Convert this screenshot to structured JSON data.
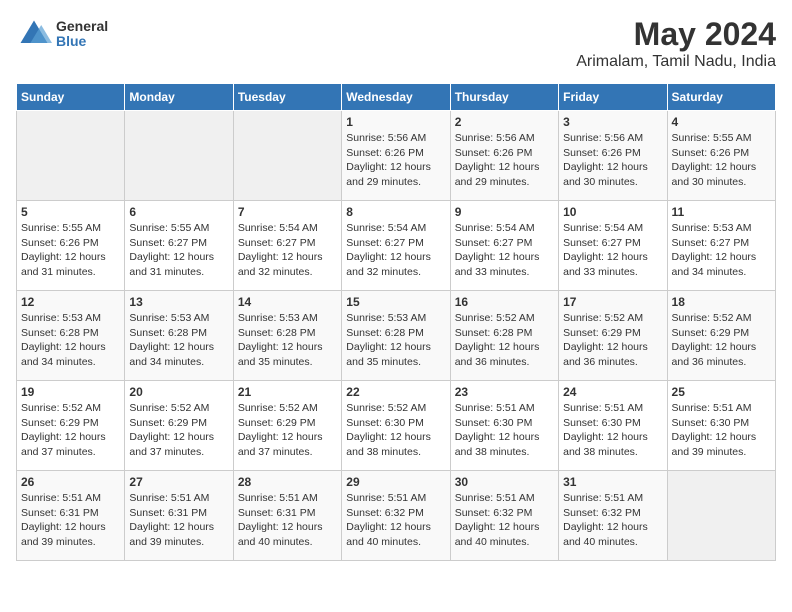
{
  "header": {
    "logo_line1": "General",
    "logo_line2": "Blue",
    "title": "May 2024",
    "subtitle": "Arimalam, Tamil Nadu, India"
  },
  "calendar": {
    "days_of_week": [
      "Sunday",
      "Monday",
      "Tuesday",
      "Wednesday",
      "Thursday",
      "Friday",
      "Saturday"
    ],
    "weeks": [
      [
        {
          "day": "",
          "info": ""
        },
        {
          "day": "",
          "info": ""
        },
        {
          "day": "",
          "info": ""
        },
        {
          "day": "1",
          "info": "Sunrise: 5:56 AM\nSunset: 6:26 PM\nDaylight: 12 hours\nand 29 minutes."
        },
        {
          "day": "2",
          "info": "Sunrise: 5:56 AM\nSunset: 6:26 PM\nDaylight: 12 hours\nand 29 minutes."
        },
        {
          "day": "3",
          "info": "Sunrise: 5:56 AM\nSunset: 6:26 PM\nDaylight: 12 hours\nand 30 minutes."
        },
        {
          "day": "4",
          "info": "Sunrise: 5:55 AM\nSunset: 6:26 PM\nDaylight: 12 hours\nand 30 minutes."
        }
      ],
      [
        {
          "day": "5",
          "info": "Sunrise: 5:55 AM\nSunset: 6:26 PM\nDaylight: 12 hours\nand 31 minutes."
        },
        {
          "day": "6",
          "info": "Sunrise: 5:55 AM\nSunset: 6:27 PM\nDaylight: 12 hours\nand 31 minutes."
        },
        {
          "day": "7",
          "info": "Sunrise: 5:54 AM\nSunset: 6:27 PM\nDaylight: 12 hours\nand 32 minutes."
        },
        {
          "day": "8",
          "info": "Sunrise: 5:54 AM\nSunset: 6:27 PM\nDaylight: 12 hours\nand 32 minutes."
        },
        {
          "day": "9",
          "info": "Sunrise: 5:54 AM\nSunset: 6:27 PM\nDaylight: 12 hours\nand 33 minutes."
        },
        {
          "day": "10",
          "info": "Sunrise: 5:54 AM\nSunset: 6:27 PM\nDaylight: 12 hours\nand 33 minutes."
        },
        {
          "day": "11",
          "info": "Sunrise: 5:53 AM\nSunset: 6:27 PM\nDaylight: 12 hours\nand 34 minutes."
        }
      ],
      [
        {
          "day": "12",
          "info": "Sunrise: 5:53 AM\nSunset: 6:28 PM\nDaylight: 12 hours\nand 34 minutes."
        },
        {
          "day": "13",
          "info": "Sunrise: 5:53 AM\nSunset: 6:28 PM\nDaylight: 12 hours\nand 34 minutes."
        },
        {
          "day": "14",
          "info": "Sunrise: 5:53 AM\nSunset: 6:28 PM\nDaylight: 12 hours\nand 35 minutes."
        },
        {
          "day": "15",
          "info": "Sunrise: 5:53 AM\nSunset: 6:28 PM\nDaylight: 12 hours\nand 35 minutes."
        },
        {
          "day": "16",
          "info": "Sunrise: 5:52 AM\nSunset: 6:28 PM\nDaylight: 12 hours\nand 36 minutes."
        },
        {
          "day": "17",
          "info": "Sunrise: 5:52 AM\nSunset: 6:29 PM\nDaylight: 12 hours\nand 36 minutes."
        },
        {
          "day": "18",
          "info": "Sunrise: 5:52 AM\nSunset: 6:29 PM\nDaylight: 12 hours\nand 36 minutes."
        }
      ],
      [
        {
          "day": "19",
          "info": "Sunrise: 5:52 AM\nSunset: 6:29 PM\nDaylight: 12 hours\nand 37 minutes."
        },
        {
          "day": "20",
          "info": "Sunrise: 5:52 AM\nSunset: 6:29 PM\nDaylight: 12 hours\nand 37 minutes."
        },
        {
          "day": "21",
          "info": "Sunrise: 5:52 AM\nSunset: 6:29 PM\nDaylight: 12 hours\nand 37 minutes."
        },
        {
          "day": "22",
          "info": "Sunrise: 5:52 AM\nSunset: 6:30 PM\nDaylight: 12 hours\nand 38 minutes."
        },
        {
          "day": "23",
          "info": "Sunrise: 5:51 AM\nSunset: 6:30 PM\nDaylight: 12 hours\nand 38 minutes."
        },
        {
          "day": "24",
          "info": "Sunrise: 5:51 AM\nSunset: 6:30 PM\nDaylight: 12 hours\nand 38 minutes."
        },
        {
          "day": "25",
          "info": "Sunrise: 5:51 AM\nSunset: 6:30 PM\nDaylight: 12 hours\nand 39 minutes."
        }
      ],
      [
        {
          "day": "26",
          "info": "Sunrise: 5:51 AM\nSunset: 6:31 PM\nDaylight: 12 hours\nand 39 minutes."
        },
        {
          "day": "27",
          "info": "Sunrise: 5:51 AM\nSunset: 6:31 PM\nDaylight: 12 hours\nand 39 minutes."
        },
        {
          "day": "28",
          "info": "Sunrise: 5:51 AM\nSunset: 6:31 PM\nDaylight: 12 hours\nand 40 minutes."
        },
        {
          "day": "29",
          "info": "Sunrise: 5:51 AM\nSunset: 6:32 PM\nDaylight: 12 hours\nand 40 minutes."
        },
        {
          "day": "30",
          "info": "Sunrise: 5:51 AM\nSunset: 6:32 PM\nDaylight: 12 hours\nand 40 minutes."
        },
        {
          "day": "31",
          "info": "Sunrise: 5:51 AM\nSunset: 6:32 PM\nDaylight: 12 hours\nand 40 minutes."
        },
        {
          "day": "",
          "info": ""
        }
      ]
    ]
  }
}
